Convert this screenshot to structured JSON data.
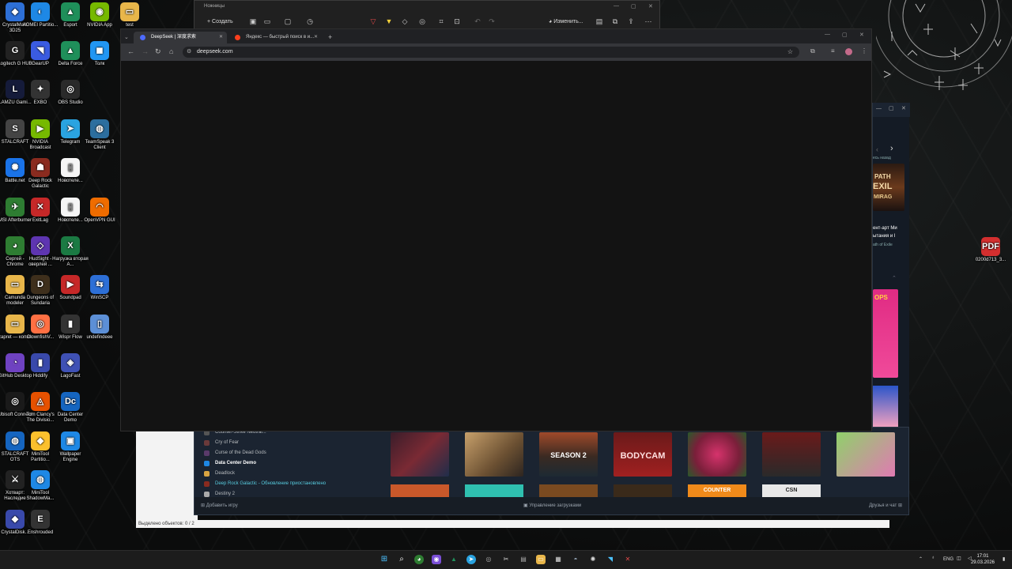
{
  "desktop": {
    "icons": [
      {
        "label": "CrystalMark 3D25",
        "glyph": "◆",
        "color": "#2d6fd6"
      },
      {
        "label": "AOMEI Partitio...",
        "glyph": "◐",
        "color": "#1e88e5"
      },
      {
        "label": "Esport",
        "glyph": "▲",
        "color": "#1f8f5a"
      },
      {
        "label": "NVIDIA App",
        "glyph": "◉",
        "color": "#76b900"
      },
      {
        "label": "test",
        "glyph": "▭",
        "color": "#e8b64a"
      },
      {
        "label": "Logitech G HUB",
        "glyph": "G",
        "color": "#222"
      },
      {
        "label": "GearUP",
        "glyph": "◥",
        "color": "#3a5be0"
      },
      {
        "label": "Delta Force",
        "glyph": "▲",
        "color": "#1f8f5a"
      },
      {
        "label": "Толк",
        "glyph": "◼",
        "color": "#2196f3"
      },
      {
        "label": "LAMZU Gami...",
        "glyph": "L",
        "color": "#151b3a"
      },
      {
        "label": "EXBO",
        "glyph": "✦",
        "color": "#333"
      },
      {
        "label": "OBS Studio",
        "glyph": "◎",
        "color": "#2a2a2a"
      },
      {
        "label": "STALCRAFT",
        "glyph": "S",
        "color": "#444"
      },
      {
        "label": "NVIDIA Broadcast",
        "glyph": "▶",
        "color": "#76b900"
      },
      {
        "label": "Telegram",
        "glyph": "➤",
        "color": "#2aa3e0"
      },
      {
        "label": "TeamSpeak 3 Client",
        "glyph": "◍",
        "color": "#2c6e9e"
      },
      {
        "label": "Battle.net",
        "glyph": "✺",
        "color": "#1a73e8"
      },
      {
        "label": "Deep Rock Galactic",
        "glyph": "☗",
        "color": "#8a2b1f"
      },
      {
        "label": "Новотеле...",
        "glyph": "▯",
        "color": "#f5f5f5"
      },
      {
        "label": "MSI Afterburner",
        "glyph": "✈",
        "color": "#2e7d32"
      },
      {
        "label": "ExitLag",
        "glyph": "✕",
        "color": "#c62828"
      },
      {
        "label": "Новотеле...",
        "glyph": "▯",
        "color": "#f5f5f5"
      },
      {
        "label": "OpenVPN GUI",
        "glyph": "◠",
        "color": "#ef6c00"
      },
      {
        "label": "Сергей - Chrome",
        "glyph": "◕",
        "color": "#2e7d32"
      },
      {
        "label": "HudSight - оверлей ...",
        "glyph": "◇",
        "color": "#5e35b1"
      },
      {
        "label": "Нагрузка вторая A...",
        "glyph": "X",
        "color": "#1b7a43"
      },
      {
        "label": "Camunda modeler",
        "glyph": "▭",
        "color": "#e8b64a"
      },
      {
        "label": "Dungeons of Sundaria",
        "glyph": "D",
        "color": "#3e2f1c"
      },
      {
        "label": "Soundpad",
        "glyph": "▶",
        "color": "#c62828"
      },
      {
        "label": "WinSCP",
        "glyph": "⇆",
        "color": "#2d6fd6"
      },
      {
        "label": "zapret — копия",
        "glyph": "▭",
        "color": "#e8b64a"
      },
      {
        "label": "ClownfishV...",
        "glyph": "◎",
        "color": "#ff7043"
      },
      {
        "label": "Wispr Flow",
        "glyph": "▮",
        "color": "#333"
      },
      {
        "label": "undefindeee",
        "glyph": "▯",
        "color": "#5c8fd6"
      },
      {
        "label": "GitHub Desktop",
        "glyph": "◔",
        "color": "#6f42c1"
      },
      {
        "label": "Hiddify",
        "glyph": "▮",
        "color": "#3949ab"
      },
      {
        "label": "LagoFast",
        "glyph": "◈",
        "color": "#3f51b5"
      },
      {
        "label": "Ubisoft Connect",
        "glyph": "◎",
        "color": "#1a1a1a"
      },
      {
        "label": "Tom Clancy's The Divisio...",
        "glyph": "◬",
        "color": "#e65100"
      },
      {
        "label": "Data Center Demo",
        "glyph": "Dc",
        "color": "#1565c0"
      },
      {
        "label": "STALCRAFT OTS",
        "glyph": "◍",
        "color": "#1565c0"
      },
      {
        "label": "MiniTool Partitio...",
        "glyph": "◆",
        "color": "#fbc02d"
      },
      {
        "label": "Wallpaper Engine",
        "glyph": "▣",
        "color": "#1e88e5"
      },
      {
        "label": "Хотварт: Наследие",
        "glyph": "⚔",
        "color": "#222"
      },
      {
        "label": "MiniTool ShadowMa...",
        "glyph": "◍",
        "color": "#1e88e5"
      },
      {
        "label": "CrystalDisk...",
        "glyph": "◆",
        "color": "#3949ab"
      },
      {
        "label": "Enshrouded",
        "glyph": "E",
        "color": "#333"
      },
      {
        "label": "0200d713_3...",
        "glyph": "PDF",
        "color": "#d32f2f"
      }
    ]
  },
  "snipping_tool": {
    "title": "Ножницы",
    "create_label": "+ Создать",
    "edit_label": "Изменить..."
  },
  "browser": {
    "tabs": [
      {
        "label": "DeepSeek | 深度求索",
        "color": "#4d6bfe"
      },
      {
        "label": "Яндекс — быстрый поиск в и...",
        "color": "#fc3f1d"
      }
    ],
    "address": "deepseek.com"
  },
  "steam": {
    "games": [
      {
        "label": "Counter-Strike Neutral...",
        "cls": ""
      },
      {
        "label": "Cry of Fear",
        "cls": ""
      },
      {
        "label": "Curse of the Dead Gods",
        "cls": ""
      },
      {
        "label": "Data Center Demo",
        "cls": "hl"
      },
      {
        "label": "Deadlock",
        "cls": ""
      },
      {
        "label": "Deep Rock Galactic - Обновление приостановлено",
        "cls": "upd"
      },
      {
        "label": "Destiny 2",
        "cls": ""
      }
    ],
    "add_game": "Добавить игру",
    "downloads": "Управление загрузками",
    "friends": "Друзья и чат",
    "tiles": [
      {
        "text": "",
        "bg": "linear-gradient(135deg,#3a1d2a,#7a2a34 50%,#1f2d4a)"
      },
      {
        "text": "",
        "bg": "linear-gradient(135deg,#c7a06b,#6b5032 60%,#2d2520)"
      },
      {
        "text": "SEASON 2",
        "bg": "linear-gradient(180deg,#a04a2a,#3a2a22 55%,#1d2a33)"
      },
      {
        "text": "BODYCAM",
        "bg": "linear-gradient(180deg,#6b1a1a,#a02020)"
      },
      {
        "text": "",
        "bg": "radial-gradient(circle,#d6336c,#7a1f3a 60%,#2a5a2a)"
      },
      {
        "text": "",
        "bg": "linear-gradient(180deg,#6a1a1a,#2a2a2a)"
      },
      {
        "text": "",
        "bg": "linear-gradient(135deg,#8fd16a,#e07ab2)"
      }
    ],
    "news": {
      "back": "есь назад",
      "line1": "ент-арт Ми",
      "line2": "ытания и I",
      "source": "ath of Exile",
      "logo1": "PATH",
      "logo2": "EXIL",
      "logo3": "MIRAG"
    }
  },
  "explorer": {
    "status": "Выделено объектов: 0 / 2"
  },
  "taskbar": {
    "lang": "ENG",
    "time": "17:01",
    "date": "29.03.2026"
  }
}
